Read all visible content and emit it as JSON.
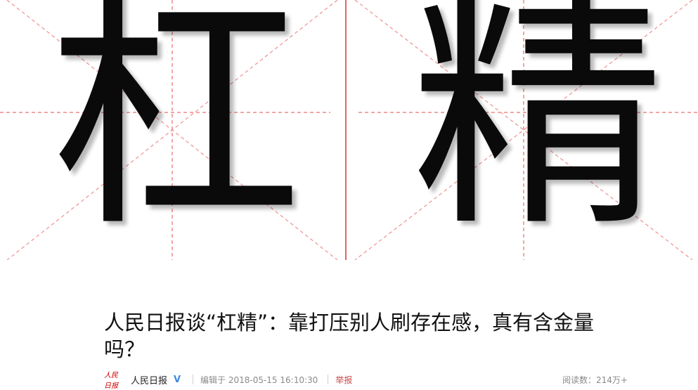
{
  "hero": {
    "char_left": "杠",
    "char_right": "精"
  },
  "article": {
    "title": "人民日报谈“杠精”：靠打压别人刷存在感，真有含金量吗？"
  },
  "meta": {
    "logo_text": "人民日报",
    "author": "人民日报",
    "verified_mark": "V",
    "edited": "编辑于 2018-05-15 16:10:30",
    "report": "举报",
    "reads": "阅读数：214万+"
  },
  "colors": {
    "guide_red": "#e57373",
    "report_red": "#c84a4a",
    "verified_blue": "#3a8be0"
  }
}
